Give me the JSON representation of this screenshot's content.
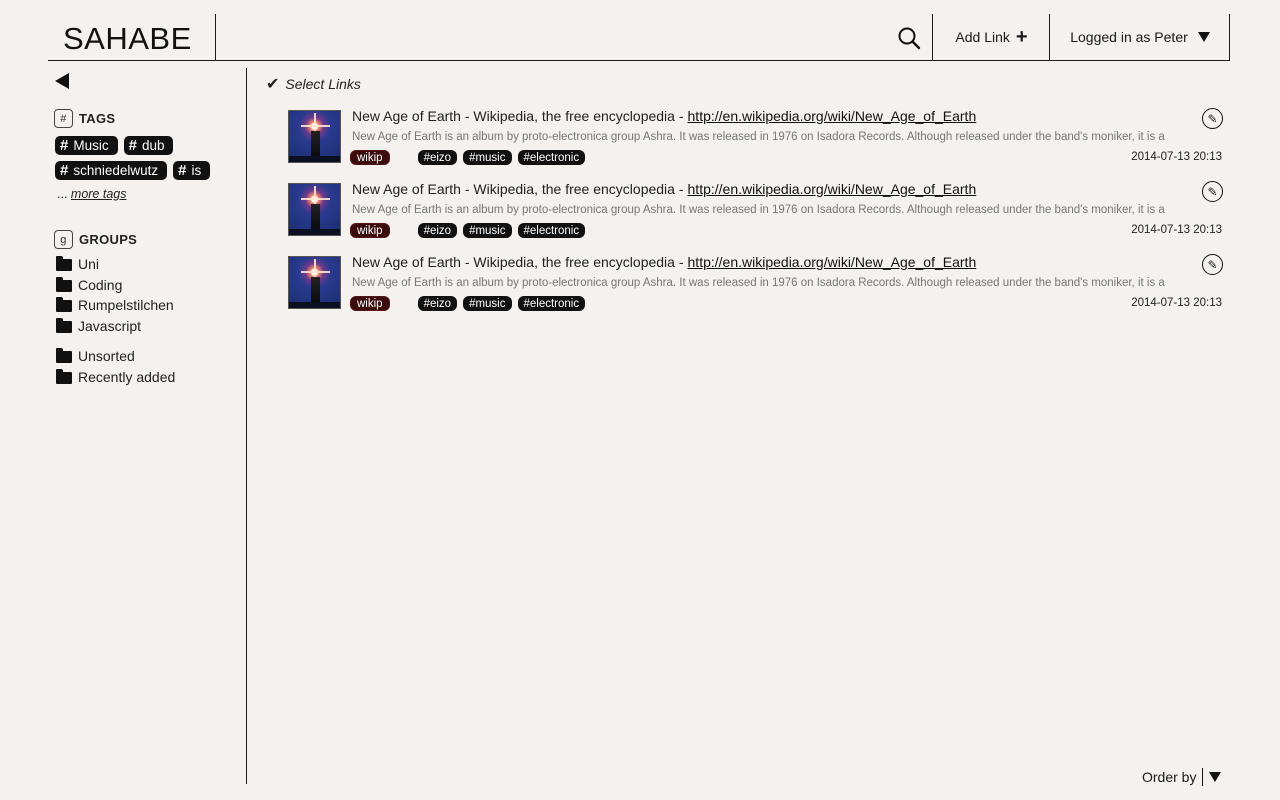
{
  "header": {
    "logo": "SAHABE",
    "add_link_label": "Add Link",
    "add_link_icon": "+",
    "user_label": "Logged in as Peter"
  },
  "sidebar": {
    "tags_title": "TAGS",
    "tags_icon": "#",
    "tags": [
      {
        "label": "Music"
      },
      {
        "label": "dub"
      },
      {
        "label": "schniedelwutz"
      },
      {
        "label": "is"
      }
    ],
    "more_prefix": "...",
    "more_tags_label": "more tags",
    "groups_title": "GROUPS",
    "groups_icon": "g",
    "groups": [
      "Uni",
      "Coding",
      "Rumpelstilchen",
      "Javascript"
    ],
    "special_groups": [
      "Unsorted",
      "Recently added"
    ]
  },
  "main": {
    "select_links_label": "Select Links",
    "links": [
      {
        "title": "New Age of Earth - Wikipedia, the free encyclopedia -",
        "url": "http://en.wikipedia.org/wiki/New_Age_of_Earth",
        "description": "New Age of Earth is an album by proto-electronica group Ashra. It was released in 1976 on Isadora Records. Although released under the band's moniker, it is a",
        "source_tag": "wikip",
        "tags": [
          "#eizo",
          "#music",
          "#electronic"
        ],
        "date": "2014-07-13 20:13"
      },
      {
        "title": "New Age of Earth - Wikipedia, the free encyclopedia -",
        "url": "http://en.wikipedia.org/wiki/New_Age_of_Earth",
        "description": "New Age of Earth is an album by proto-electronica group Ashra. It was released in 1976 on Isadora Records. Although released under the band's moniker, it is a",
        "source_tag": "wikip",
        "tags": [
          "#eizo",
          "#music",
          "#electronic"
        ],
        "date": "2014-07-13 20:13"
      },
      {
        "title": "New Age of Earth - Wikipedia, the free encyclopedia -",
        "url": "http://en.wikipedia.org/wiki/New_Age_of_Earth",
        "description": "New Age of Earth is an album by proto-electronica group Ashra. It was released in 1976 on Isadora Records. Although released under the band's moniker, it is a",
        "source_tag": "wikip",
        "tags": [
          "#eizo",
          "#music",
          "#electronic"
        ],
        "date": "2014-07-13 20:13"
      }
    ]
  },
  "footer": {
    "order_by_label": "Order by"
  }
}
